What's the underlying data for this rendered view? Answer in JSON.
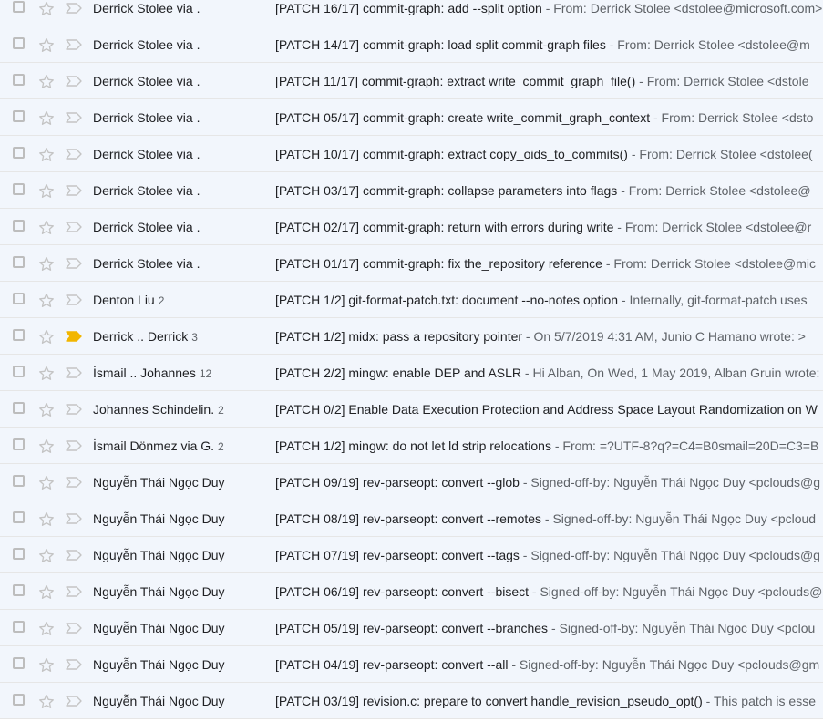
{
  "colors": {
    "row_bg": "#f2f6fc",
    "important_marker": "#f2b600",
    "icon_gray": "#c4c4c4"
  },
  "icons": {
    "checkbox": "checkbox-icon",
    "star": "star-icon",
    "important": "importance-marker-icon"
  },
  "rows": [
    {
      "sender": "Derrick Stolee via .",
      "count": "",
      "subject": "[PATCH 16/17] commit-graph: add --split option",
      "snippet": "From: Derrick Stolee <dstolee@microsoft.com>",
      "important": false
    },
    {
      "sender": "Derrick Stolee via .",
      "count": "",
      "subject": "[PATCH 14/17] commit-graph: load split commit-graph files",
      "snippet": "From: Derrick Stolee <dstolee@m",
      "important": false
    },
    {
      "sender": "Derrick Stolee via .",
      "count": "",
      "subject": "[PATCH 11/17] commit-graph: extract write_commit_graph_file()",
      "snippet": "From: Derrick Stolee <dstole",
      "important": false
    },
    {
      "sender": "Derrick Stolee via .",
      "count": "",
      "subject": "[PATCH 05/17] commit-graph: create write_commit_graph_context",
      "snippet": "From: Derrick Stolee <dsto",
      "important": false
    },
    {
      "sender": "Derrick Stolee via .",
      "count": "",
      "subject": "[PATCH 10/17] commit-graph: extract copy_oids_to_commits()",
      "snippet": "From: Derrick Stolee <dstolee(",
      "important": false
    },
    {
      "sender": "Derrick Stolee via .",
      "count": "",
      "subject": "[PATCH 03/17] commit-graph: collapse parameters into flags",
      "snippet": "From: Derrick Stolee <dstolee@",
      "important": false
    },
    {
      "sender": "Derrick Stolee via .",
      "count": "",
      "subject": "[PATCH 02/17] commit-graph: return with errors during write",
      "snippet": "From: Derrick Stolee <dstolee@r",
      "important": false
    },
    {
      "sender": "Derrick Stolee via .",
      "count": "",
      "subject": "[PATCH 01/17] commit-graph: fix the_repository reference",
      "snippet": "From: Derrick Stolee <dstolee@mic",
      "important": false
    },
    {
      "sender": "Denton Liu",
      "count": "2",
      "subject": "[PATCH 1/2] git-format-patch.txt: document --no-notes option",
      "snippet": "Internally, git-format-patch uses",
      "important": false
    },
    {
      "sender": "Derrick .. Derrick",
      "count": "3",
      "subject": "[PATCH 1/2] midx: pass a repository pointer",
      "snippet": "On 5/7/2019 4:31 AM, Junio C Hamano wrote: >",
      "important": true
    },
    {
      "sender": "İsmail .. Johannes",
      "count": "12",
      "subject": "[PATCH 2/2] mingw: enable DEP and ASLR",
      "snippet": "Hi Alban, On Wed, 1 May 2019, Alban Gruin wrote:",
      "important": false
    },
    {
      "sender": "Johannes Schindelin.",
      "count": "2",
      "subject": "[PATCH 0/2] Enable Data Execution Protection and Address Space Layout Randomization on W",
      "snippet": "",
      "important": false
    },
    {
      "sender": "İsmail Dönmez via G.",
      "count": "2",
      "subject": "[PATCH 1/2] mingw: do not let ld strip relocations",
      "snippet": "From: =?UTF-8?q?=C4=B0smail=20D=C3=B",
      "important": false
    },
    {
      "sender": "Nguyễn Thái Ngọc Duy",
      "count": "",
      "subject": "[PATCH 09/19] rev-parseopt: convert --glob",
      "snippet": "Signed-off-by: Nguyễn Thái Ngọc Duy <pclouds@g",
      "important": false
    },
    {
      "sender": "Nguyễn Thái Ngọc Duy",
      "count": "",
      "subject": "[PATCH 08/19] rev-parseopt: convert --remotes",
      "snippet": "Signed-off-by: Nguyễn Thái Ngọc Duy <pcloud",
      "important": false
    },
    {
      "sender": "Nguyễn Thái Ngọc Duy",
      "count": "",
      "subject": "[PATCH 07/19] rev-parseopt: convert --tags",
      "snippet": "Signed-off-by: Nguyễn Thái Ngọc Duy <pclouds@g",
      "important": false
    },
    {
      "sender": "Nguyễn Thái Ngọc Duy",
      "count": "",
      "subject": "[PATCH 06/19] rev-parseopt: convert --bisect",
      "snippet": "Signed-off-by: Nguyễn Thái Ngọc Duy <pclouds@",
      "important": false
    },
    {
      "sender": "Nguyễn Thái Ngọc Duy",
      "count": "",
      "subject": "[PATCH 05/19] rev-parseopt: convert --branches",
      "snippet": "Signed-off-by: Nguyễn Thái Ngọc Duy <pclou",
      "important": false
    },
    {
      "sender": "Nguyễn Thái Ngọc Duy",
      "count": "",
      "subject": "[PATCH 04/19] rev-parseopt: convert --all",
      "snippet": "Signed-off-by: Nguyễn Thái Ngọc Duy <pclouds@gm",
      "important": false
    },
    {
      "sender": "Nguyễn Thái Ngọc Duy",
      "count": "",
      "subject": "[PATCH 03/19] revision.c: prepare to convert handle_revision_pseudo_opt()",
      "snippet": "This patch is esse",
      "important": false
    }
  ]
}
